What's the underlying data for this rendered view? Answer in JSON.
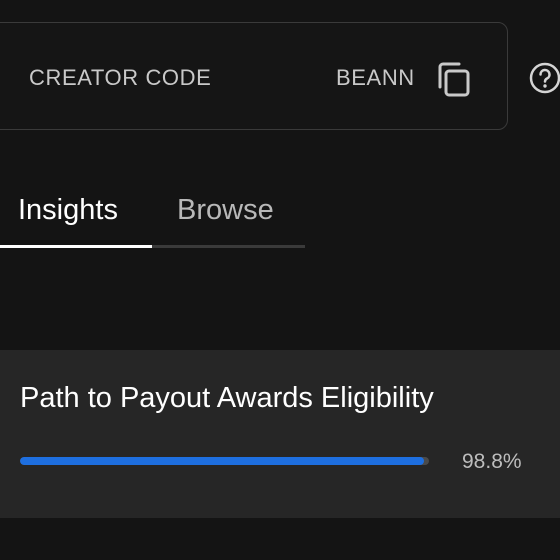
{
  "creator_code": {
    "label": "CREATOR CODE",
    "value": "BEANN",
    "copy_icon": "copy-icon",
    "help_icon": "help-icon"
  },
  "tabs": [
    {
      "label": "Insights",
      "active": true
    },
    {
      "label": "Browse",
      "active": false
    }
  ],
  "payout": {
    "title": "Path to Payout Awards Eligibility",
    "progress_fraction": 0.988,
    "progress_text": "98.8%"
  },
  "colors": {
    "background": "#141414",
    "card": "#262626",
    "accent": "#1e6fe0"
  }
}
